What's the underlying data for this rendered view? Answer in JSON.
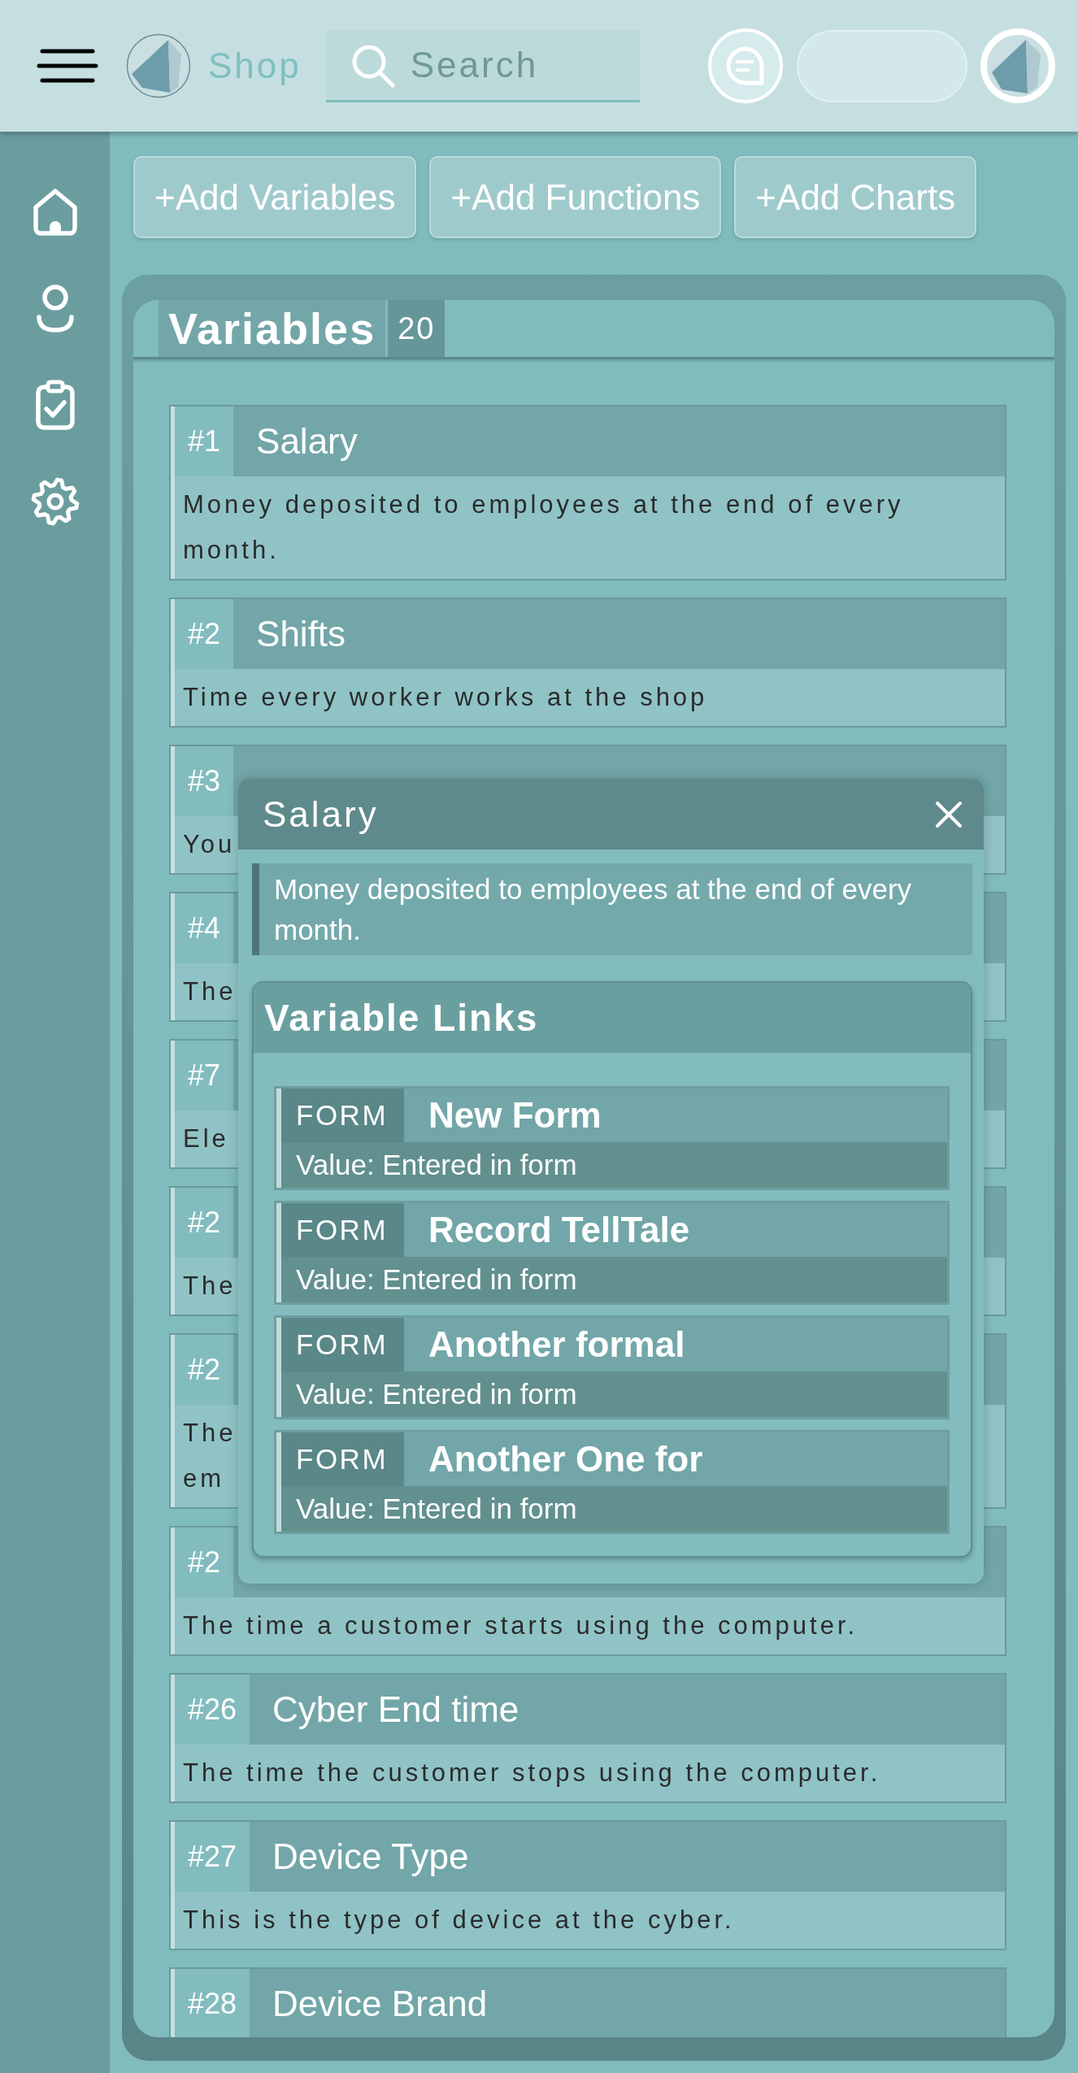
{
  "header": {
    "brand": "Shop",
    "search": {
      "placeholder": "Search"
    }
  },
  "toolbar": {
    "buttons": [
      "+Add Variables",
      "+Add Functions",
      "+Add Charts"
    ]
  },
  "variables": {
    "title": "Variables",
    "count": "20",
    "items": [
      {
        "number": "#1",
        "title": "Salary",
        "description": "Money deposited to employees at the end of every month."
      },
      {
        "number": "#2",
        "title": "Shifts",
        "description": "Time every worker works at the shop"
      },
      {
        "number": "#3",
        "description": "You"
      },
      {
        "number": "#4",
        "description": "The"
      },
      {
        "number": "#7",
        "description": "Ele"
      },
      {
        "number": "#2",
        "description": "The"
      },
      {
        "number": "#2",
        "description": "The\nem"
      },
      {
        "number": "#2",
        "description": "The time a customer starts using the computer."
      },
      {
        "number": "#26",
        "title": "Cyber End time",
        "description": "The time the customer stops using the computer."
      },
      {
        "number": "#27",
        "title": "Device Type",
        "description": "This is the type of device at the cyber."
      },
      {
        "number": "#28",
        "title": "Device Brand"
      }
    ]
  },
  "dialog": {
    "title": "Salary",
    "description": "Money deposited to employees at the end of every month.",
    "links": {
      "title": "Variable Links",
      "items": [
        {
          "type": "FORM",
          "title": "New Form",
          "value": "Value: Entered in form"
        },
        {
          "type": "FORM",
          "title": "Record TellTale",
          "value": "Value: Entered in form"
        },
        {
          "type": "FORM",
          "title": "Another formal",
          "value": "Value: Entered in form"
        },
        {
          "type": "FORM",
          "title": "Another One for",
          "value": "Value: Entered in form"
        }
      ]
    }
  }
}
